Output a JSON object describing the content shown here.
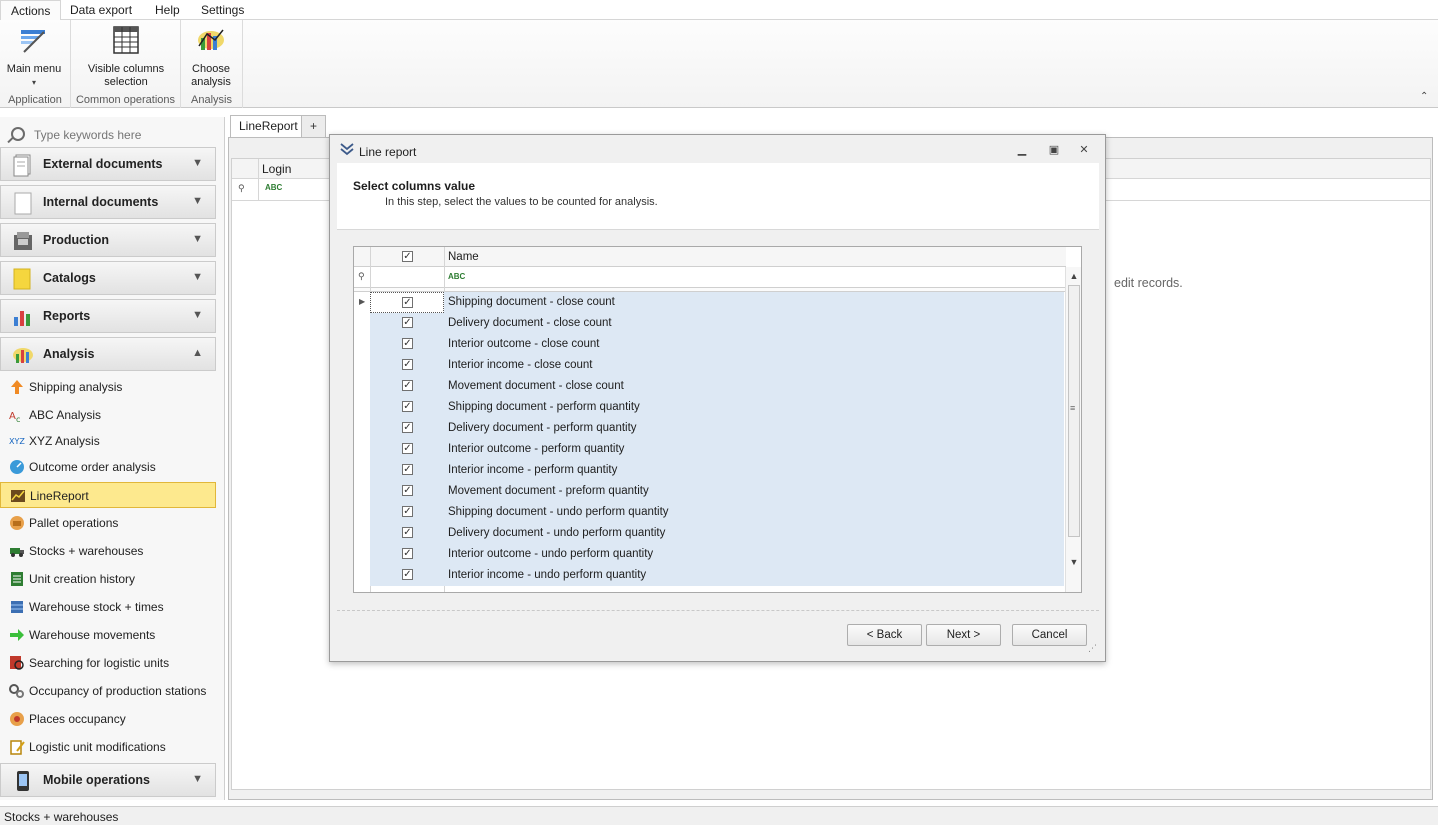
{
  "menu": {
    "tabs": [
      "Actions",
      "Data export",
      "Help",
      "Settings"
    ]
  },
  "ribbon": {
    "main_menu": "Main menu",
    "visible_columns_1": "Visible columns",
    "visible_columns_2": "selection",
    "choose_analysis_1": "Choose",
    "choose_analysis_2": "analysis",
    "groups": [
      "Application",
      "Common operations",
      "Analysis"
    ]
  },
  "nav": {
    "search_placeholder": "Type keywords here",
    "sections": [
      "External documents",
      "Internal documents",
      "Production",
      "Catalogs",
      "Reports",
      "Analysis",
      "Mobile operations"
    ],
    "items": [
      "Shipping analysis",
      "ABC Analysis",
      "XYZ Analysis",
      "Outcome order analysis",
      "LineReport",
      "Pallet operations",
      "Stocks + warehouses",
      "Unit creation history",
      "Warehouse stock + times",
      "Warehouse movements",
      "Searching for logistic units",
      "Occupancy of production stations",
      "Places occupancy",
      "Logistic unit modifications"
    ]
  },
  "workspace": {
    "tab_label": "LineReport",
    "add_tab": "+",
    "grid_header": "Login",
    "bg_message": "edit records."
  },
  "dialog": {
    "title": "Line report",
    "heading": "Select columns value",
    "subheading": "In this step, select the values to be counted for analysis.",
    "col_name": "Name",
    "rows": [
      "Shipping document - close count",
      "Delivery document - close count",
      "Interior outcome - close count",
      "Interior income - close count",
      "Movement document - close count",
      "Shipping document - perform quantity",
      "Delivery document - perform quantity",
      "Interior outcome - perform quantity",
      "Interior income - perform quantity",
      "Movement document - preform quantity",
      "Shipping document - undo perform quantity",
      "Delivery document - undo perform quantity",
      "Interior outcome - undo perform quantity",
      "Interior income - undo perform quantity"
    ],
    "back": "< Back",
    "next": "Next >",
    "cancel": "Cancel"
  },
  "status": {
    "text": "Stocks + warehouses"
  }
}
